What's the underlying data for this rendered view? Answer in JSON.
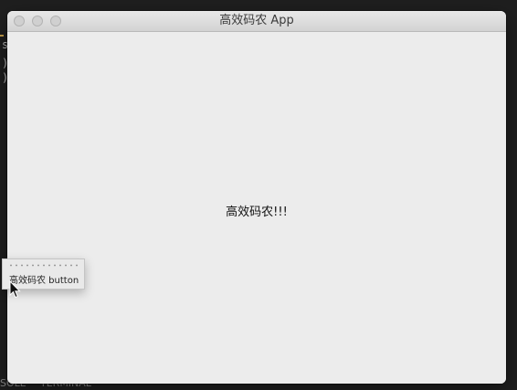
{
  "window": {
    "title": "高效码农 App"
  },
  "content": {
    "center_text": "高效码农!!!"
  },
  "floating_button": {
    "label": "高效码农 button"
  },
  "background": {
    "left_glyphs": [
      "s",
      ")",
      ")"
    ],
    "bottom_bar": [
      "SOLE",
      "TERMINAL"
    ]
  },
  "colors": {
    "window_bg": "#ececec",
    "titlebar": "#dcdcdc",
    "desktop_bg": "#1e1e1e",
    "accent": "#c9a14a"
  },
  "icons": {
    "cursor": "arrow-pointer-icon",
    "traffic_lights": [
      "close-icon",
      "minimize-icon",
      "zoom-icon"
    ]
  }
}
